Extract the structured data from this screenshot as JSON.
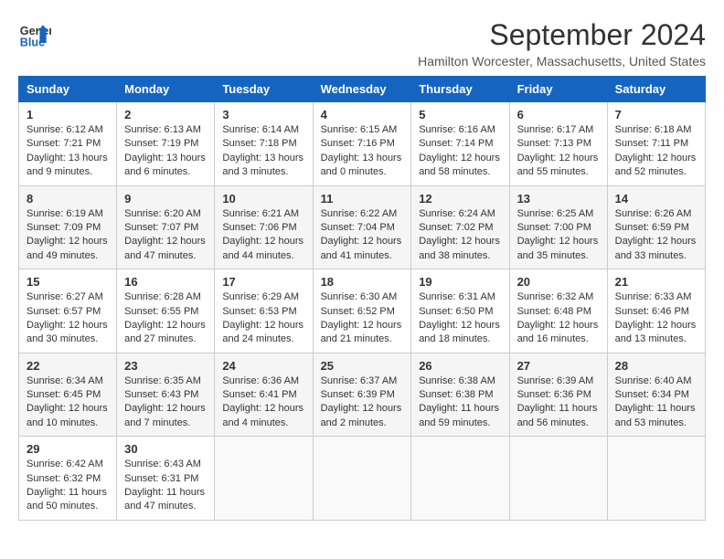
{
  "header": {
    "logo_line1": "General",
    "logo_line2": "Blue",
    "month": "September 2024",
    "location": "Hamilton Worcester, Massachusetts, United States"
  },
  "days_of_week": [
    "Sunday",
    "Monday",
    "Tuesday",
    "Wednesday",
    "Thursday",
    "Friday",
    "Saturday"
  ],
  "weeks": [
    [
      {
        "day": "1",
        "sunrise": "6:12 AM",
        "sunset": "7:21 PM",
        "daylight": "13 hours and 9 minutes."
      },
      {
        "day": "2",
        "sunrise": "6:13 AM",
        "sunset": "7:19 PM",
        "daylight": "13 hours and 6 minutes."
      },
      {
        "day": "3",
        "sunrise": "6:14 AM",
        "sunset": "7:18 PM",
        "daylight": "13 hours and 3 minutes."
      },
      {
        "day": "4",
        "sunrise": "6:15 AM",
        "sunset": "7:16 PM",
        "daylight": "13 hours and 0 minutes."
      },
      {
        "day": "5",
        "sunrise": "6:16 AM",
        "sunset": "7:14 PM",
        "daylight": "12 hours and 58 minutes."
      },
      {
        "day": "6",
        "sunrise": "6:17 AM",
        "sunset": "7:13 PM",
        "daylight": "12 hours and 55 minutes."
      },
      {
        "day": "7",
        "sunrise": "6:18 AM",
        "sunset": "7:11 PM",
        "daylight": "12 hours and 52 minutes."
      }
    ],
    [
      {
        "day": "8",
        "sunrise": "6:19 AM",
        "sunset": "7:09 PM",
        "daylight": "12 hours and 49 minutes."
      },
      {
        "day": "9",
        "sunrise": "6:20 AM",
        "sunset": "7:07 PM",
        "daylight": "12 hours and 47 minutes."
      },
      {
        "day": "10",
        "sunrise": "6:21 AM",
        "sunset": "7:06 PM",
        "daylight": "12 hours and 44 minutes."
      },
      {
        "day": "11",
        "sunrise": "6:22 AM",
        "sunset": "7:04 PM",
        "daylight": "12 hours and 41 minutes."
      },
      {
        "day": "12",
        "sunrise": "6:24 AM",
        "sunset": "7:02 PM",
        "daylight": "12 hours and 38 minutes."
      },
      {
        "day": "13",
        "sunrise": "6:25 AM",
        "sunset": "7:00 PM",
        "daylight": "12 hours and 35 minutes."
      },
      {
        "day": "14",
        "sunrise": "6:26 AM",
        "sunset": "6:59 PM",
        "daylight": "12 hours and 33 minutes."
      }
    ],
    [
      {
        "day": "15",
        "sunrise": "6:27 AM",
        "sunset": "6:57 PM",
        "daylight": "12 hours and 30 minutes."
      },
      {
        "day": "16",
        "sunrise": "6:28 AM",
        "sunset": "6:55 PM",
        "daylight": "12 hours and 27 minutes."
      },
      {
        "day": "17",
        "sunrise": "6:29 AM",
        "sunset": "6:53 PM",
        "daylight": "12 hours and 24 minutes."
      },
      {
        "day": "18",
        "sunrise": "6:30 AM",
        "sunset": "6:52 PM",
        "daylight": "12 hours and 21 minutes."
      },
      {
        "day": "19",
        "sunrise": "6:31 AM",
        "sunset": "6:50 PM",
        "daylight": "12 hours and 18 minutes."
      },
      {
        "day": "20",
        "sunrise": "6:32 AM",
        "sunset": "6:48 PM",
        "daylight": "12 hours and 16 minutes."
      },
      {
        "day": "21",
        "sunrise": "6:33 AM",
        "sunset": "6:46 PM",
        "daylight": "12 hours and 13 minutes."
      }
    ],
    [
      {
        "day": "22",
        "sunrise": "6:34 AM",
        "sunset": "6:45 PM",
        "daylight": "12 hours and 10 minutes."
      },
      {
        "day": "23",
        "sunrise": "6:35 AM",
        "sunset": "6:43 PM",
        "daylight": "12 hours and 7 minutes."
      },
      {
        "day": "24",
        "sunrise": "6:36 AM",
        "sunset": "6:41 PM",
        "daylight": "12 hours and 4 minutes."
      },
      {
        "day": "25",
        "sunrise": "6:37 AM",
        "sunset": "6:39 PM",
        "daylight": "12 hours and 2 minutes."
      },
      {
        "day": "26",
        "sunrise": "6:38 AM",
        "sunset": "6:38 PM",
        "daylight": "11 hours and 59 minutes."
      },
      {
        "day": "27",
        "sunrise": "6:39 AM",
        "sunset": "6:36 PM",
        "daylight": "11 hours and 56 minutes."
      },
      {
        "day": "28",
        "sunrise": "6:40 AM",
        "sunset": "6:34 PM",
        "daylight": "11 hours and 53 minutes."
      }
    ],
    [
      {
        "day": "29",
        "sunrise": "6:42 AM",
        "sunset": "6:32 PM",
        "daylight": "11 hours and 50 minutes."
      },
      {
        "day": "30",
        "sunrise": "6:43 AM",
        "sunset": "6:31 PM",
        "daylight": "11 hours and 47 minutes."
      },
      null,
      null,
      null,
      null,
      null
    ]
  ],
  "labels": {
    "sunrise_prefix": "Sunrise: ",
    "sunset_prefix": "Sunset: ",
    "daylight_prefix": "Daylight: "
  }
}
